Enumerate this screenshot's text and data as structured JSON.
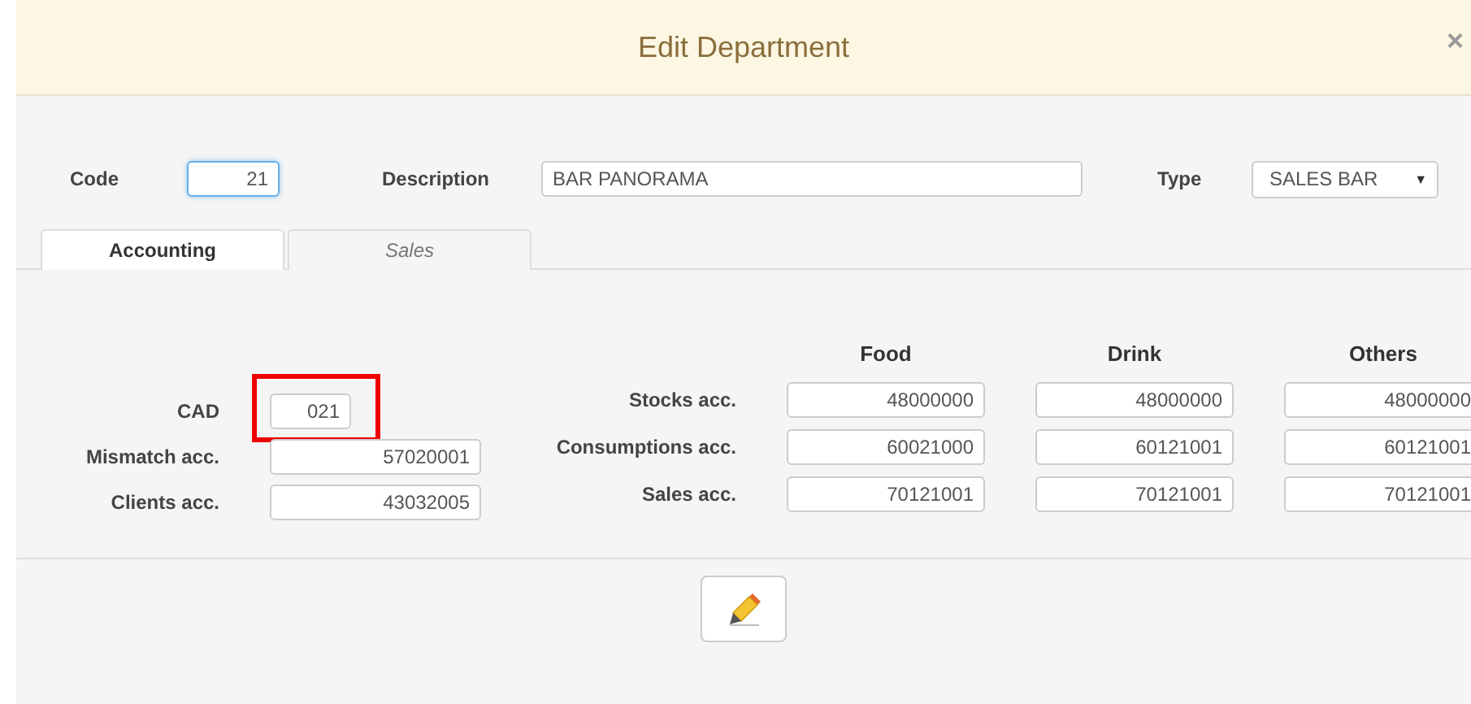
{
  "dialog": {
    "title": "Edit Department",
    "close": "×"
  },
  "header_fields": {
    "code": {
      "label": "Code",
      "value": "21",
      "focused": true
    },
    "description": {
      "label": "Description",
      "value": "BAR PANORAMA"
    },
    "type": {
      "label": "Type",
      "value": "SALES BAR",
      "caret": "▼"
    }
  },
  "tabs": [
    {
      "label": "Accounting",
      "selected": true
    },
    {
      "label": "Sales",
      "selected": false
    }
  ],
  "left_fields": [
    {
      "label": "CAD",
      "value": "021",
      "short": true,
      "highlighted": true
    },
    {
      "label": "Mismatch acc.",
      "value": "57020001",
      "short": false,
      "highlighted": false
    },
    {
      "label": "Clients acc.",
      "value": "43032005",
      "short": false,
      "highlighted": false
    }
  ],
  "columns": [
    "Food",
    "Drink",
    "Others"
  ],
  "account_rows": [
    {
      "label": "Stocks acc.",
      "values": [
        "48000000",
        "48000000",
        "48000000"
      ]
    },
    {
      "label": "Consumptions acc.",
      "values": [
        "60021000",
        "60121001",
        "60121001"
      ]
    },
    {
      "label": "Sales acc.",
      "values": [
        "70121001",
        "70121001",
        "70121001"
      ]
    }
  ]
}
